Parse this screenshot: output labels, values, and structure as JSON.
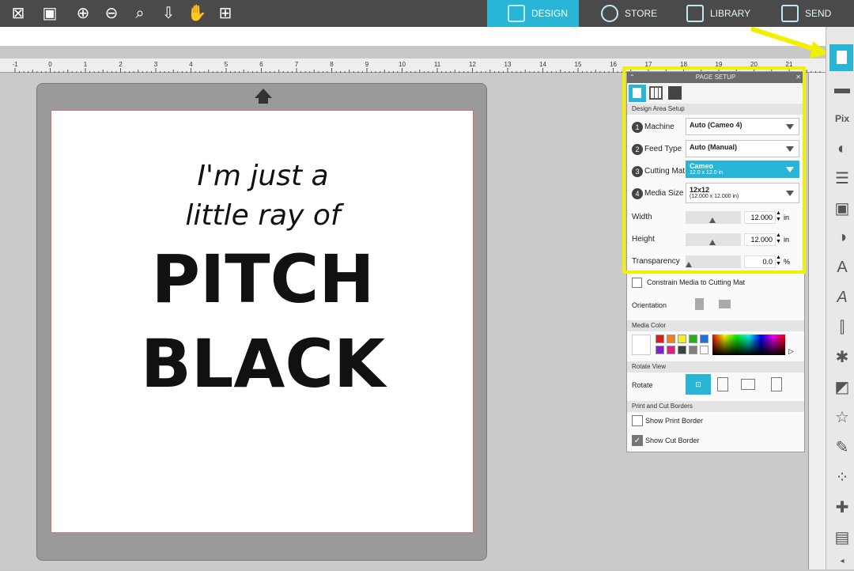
{
  "tabs": [
    {
      "label": "DESIGN",
      "active": true
    },
    {
      "label": "STORE"
    },
    {
      "label": "LIBRARY"
    },
    {
      "label": "SEND"
    }
  ],
  "ruler": {
    "labels": [
      "-1",
      "0",
      "1",
      "2",
      "3",
      "4",
      "5",
      "6",
      "7",
      "8",
      "9",
      "10",
      "11",
      "12",
      "13",
      "14",
      "15",
      "16",
      "17",
      "18",
      "19",
      "20",
      "21"
    ]
  },
  "design": {
    "lines": [
      "I'm just a",
      "little ray of",
      "PITCH",
      "BLACK"
    ]
  },
  "panel": {
    "title": "PAGE SETUP",
    "sections": {
      "design_area": "Design Area Setup",
      "media_color": "Media Color",
      "rotate_view": "Rotate View",
      "print_cut": "Print and Cut Borders"
    },
    "machine": {
      "num": "1",
      "label": "Machine",
      "value": "Auto (Cameo 4)"
    },
    "feed": {
      "num": "2",
      "label": "Feed Type",
      "value": "Auto (Manual)"
    },
    "mat": {
      "num": "3",
      "label": "Cutting Mat",
      "value": "Cameo",
      "sub": "12.0 x 12.0 in"
    },
    "media": {
      "num": "4",
      "label": "Media Size",
      "value": "12x12",
      "sub": "(12.000 x 12.000 in)"
    },
    "width": {
      "label": "Width",
      "value": "12.000",
      "unit": "in"
    },
    "height": {
      "label": "Height",
      "value": "12.000",
      "unit": "in"
    },
    "transparency": {
      "label": "Transparency",
      "value": "0.0",
      "unit": "%"
    },
    "constrain": "Constrain Media to Cutting Mat",
    "orientation": "Orientation",
    "rotate": "Rotate",
    "show_print": "Show Print Border",
    "show_cut": "Show Cut Border"
  },
  "colors": {
    "accent": "#29b6d6",
    "highlight": "#f0f000",
    "swatches": [
      "#d62020",
      "#f08020",
      "#f0f020",
      "#20b020",
      "#2070e0",
      "#8020d0",
      "#e02080",
      "#404040",
      "#808080",
      "#ffffff"
    ]
  }
}
